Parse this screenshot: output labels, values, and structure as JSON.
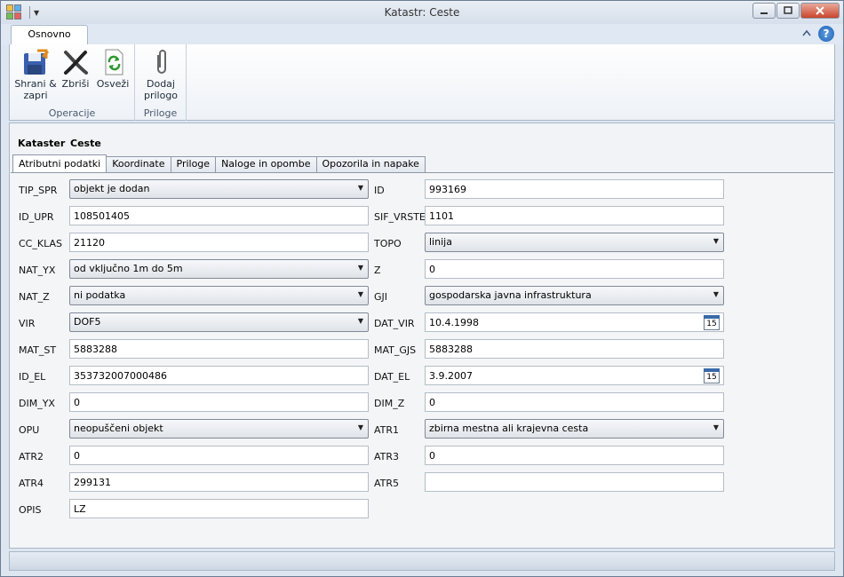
{
  "window": {
    "title": "Katastr: Ceste"
  },
  "ribbon": {
    "tab_label": "Osnovno",
    "groups": [
      {
        "label": "Operacije",
        "buttons": [
          {
            "label": "Shrani &\nzapri",
            "icon": "save-close-icon"
          },
          {
            "label": "Zbriši",
            "icon": "delete-icon"
          },
          {
            "label": "Osveži",
            "icon": "refresh-icon"
          }
        ]
      },
      {
        "label": "Priloge",
        "buttons": [
          {
            "label": "Dodaj\nprilogo",
            "icon": "paperclip-icon"
          }
        ]
      }
    ]
  },
  "breadcrumb": {
    "section": "Kataster",
    "item": "Ceste"
  },
  "tabs": [
    {
      "label": "Atributni podatki",
      "active": true
    },
    {
      "label": "Koordinate"
    },
    {
      "label": "Priloge"
    },
    {
      "label": "Naloge in opombe"
    },
    {
      "label": "Opozorila in napake"
    }
  ],
  "form": {
    "left": [
      {
        "label": "TIP_SPR",
        "type": "combo",
        "value": "objekt je dodan"
      },
      {
        "label": "ID_UPR",
        "type": "text",
        "value": "108501405"
      },
      {
        "label": "CC_KLAS",
        "type": "text",
        "value": "21120"
      },
      {
        "label": "NAT_YX",
        "type": "combo",
        "value": "od vključno 1m do 5m"
      },
      {
        "label": "NAT_Z",
        "type": "combo",
        "value": "ni podatka"
      },
      {
        "label": "VIR",
        "type": "combo",
        "value": "DOF5"
      },
      {
        "label": "MAT_ST",
        "type": "text",
        "value": "5883288"
      },
      {
        "label": "ID_EL",
        "type": "text",
        "value": "353732007000486"
      },
      {
        "label": "DIM_YX",
        "type": "text",
        "value": "0"
      },
      {
        "label": "OPU",
        "type": "combo",
        "value": "neopuščeni objekt"
      },
      {
        "label": "ATR2",
        "type": "text",
        "value": "0"
      },
      {
        "label": "ATR4",
        "type": "text",
        "value": "299131"
      },
      {
        "label": "OPIS",
        "type": "text",
        "value": "LZ"
      }
    ],
    "right": [
      {
        "label": "ID",
        "type": "text",
        "value": "993169"
      },
      {
        "label": "SIF_VRSTE",
        "type": "text",
        "value": "1101"
      },
      {
        "label": "TOPO",
        "type": "combo",
        "value": "linija"
      },
      {
        "label": "Z",
        "type": "text",
        "value": "0"
      },
      {
        "label": "GJI",
        "type": "combo",
        "value": "gospodarska javna infrastruktura"
      },
      {
        "label": "DAT_VIR",
        "type": "date",
        "value": "10.4.1998"
      },
      {
        "label": "MAT_GJS",
        "type": "text",
        "value": "5883288"
      },
      {
        "label": "DAT_EL",
        "type": "date",
        "value": "3.9.2007"
      },
      {
        "label": "DIM_Z",
        "type": "text",
        "value": "0"
      },
      {
        "label": "ATR1",
        "type": "combo",
        "value": "zbirna mestna ali krajevna cesta"
      },
      {
        "label": "ATR3",
        "type": "text",
        "value": "0"
      },
      {
        "label": "ATR5",
        "type": "text",
        "value": ""
      }
    ],
    "calendar_day": "15"
  },
  "colors": {
    "accent": "#3a6aa8",
    "close_button": "#c9452c"
  }
}
